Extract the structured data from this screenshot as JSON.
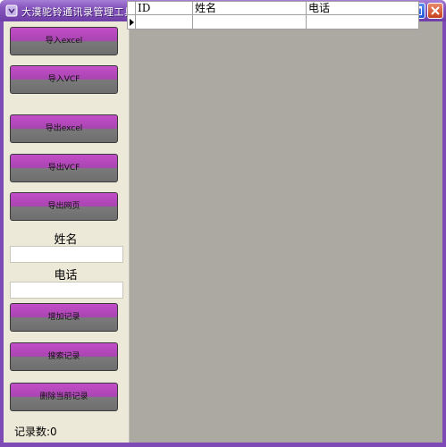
{
  "window": {
    "title": "大漠驼铃通讯录管理工具",
    "controls": [
      "minimize-icon",
      "maximize-icon",
      "close-icon"
    ]
  },
  "sidebar": {
    "import_excel": "导入excel",
    "import_vcf": "导入VCF",
    "export_excel": "导出excel",
    "export_vcf": "导出VCF",
    "export_web": "导出网页",
    "name_label": "姓名",
    "name_value": "",
    "phone_label": "电话",
    "phone_value": "",
    "add_record": "增加记录",
    "search_record": "搜索记录",
    "delete_current": "删除当前记录",
    "record_count": "记录数:0"
  },
  "grid": {
    "columns": [
      "ID",
      "姓名",
      "电话"
    ],
    "rows": [
      [
        "",
        "",
        ""
      ]
    ]
  },
  "colors": {
    "titlebar": "#8657bd",
    "button_top": "#c34dc8",
    "button_bottom": "#6e6e6e",
    "panel": "#ece9d8",
    "grid_background": "#aba9a2"
  }
}
